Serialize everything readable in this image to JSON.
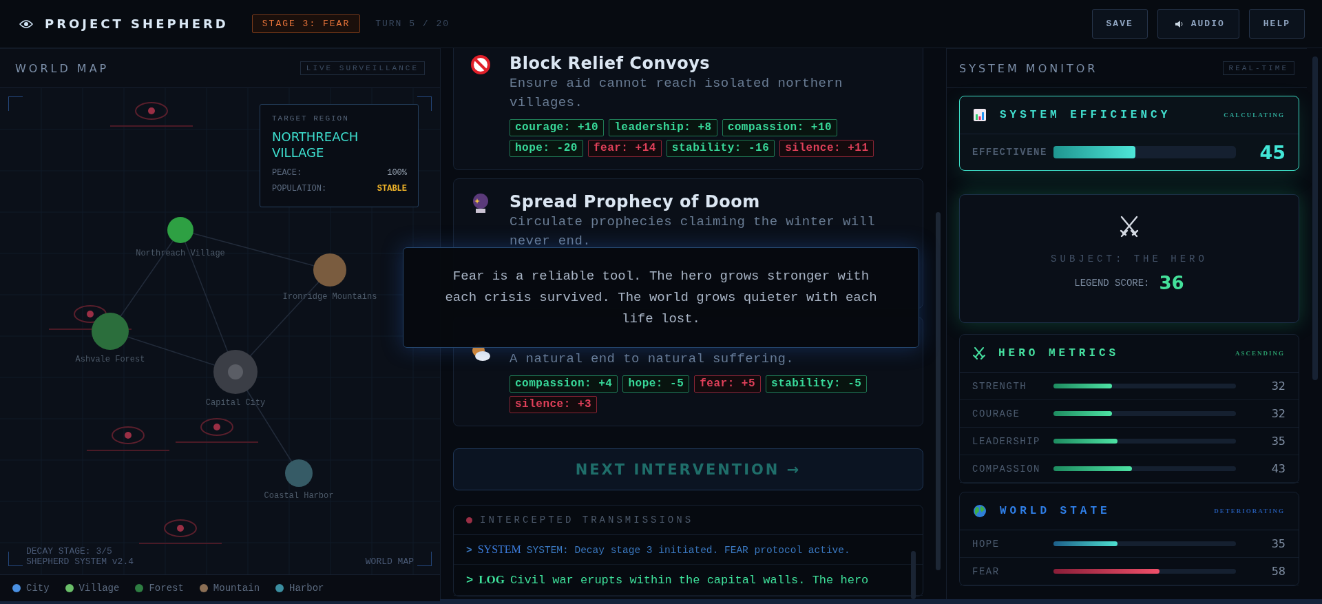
{
  "header": {
    "title": "PROJECT SHEPHERD",
    "stage": "STAGE 3: FEAR",
    "turn": "TURN 5 / 20",
    "buttons": [
      {
        "kind": "plain",
        "label": "SAVE"
      },
      {
        "kind": "audio",
        "label": "AUDIO"
      },
      {
        "kind": "plain",
        "label": "HELP"
      }
    ]
  },
  "map": {
    "title": "WORLD MAP",
    "badge": "LIVE SURVEILLANCE",
    "target": {
      "caption": "TARGET REGION",
      "name": "NORTHREACH VILLAGE",
      "stats": [
        {
          "label": "PEACE:",
          "value": "100%",
          "kind": "normal"
        },
        {
          "label": "POPULATION:",
          "value": "STABLE",
          "kind": "warn"
        }
      ]
    },
    "nodes": [
      {
        "name": "Northreach Village",
        "color": "#2ea043"
      },
      {
        "name": "Ironridge Mountains",
        "color": "#7a5c3f"
      },
      {
        "name": "Ashvale Forest",
        "color": "#2b6e3c"
      },
      {
        "name": "Capital City",
        "color": "#3b3e46"
      },
      {
        "name": "Coastal Harbor",
        "color": "#365b66"
      }
    ],
    "footer": [
      "DECAY STAGE: 3/5",
      "SHEPHERD SYSTEM v2.4"
    ],
    "corner_label": "WORLD MAP",
    "legend": [
      {
        "label": "City",
        "color": "#4a90e2"
      },
      {
        "label": "Village",
        "color": "#6abf69"
      },
      {
        "label": "Forest",
        "color": "#2e7d42"
      },
      {
        "label": "Mountain",
        "color": "#8b6f55"
      },
      {
        "label": "Harbor",
        "color": "#3b8ea0"
      }
    ]
  },
  "interventions": [
    {
      "title": "Block Relief Convoys",
      "description": "Ensure aid cannot reach isolated northern villages.",
      "effects": [
        {
          "text": "courage: +10",
          "kind": "good"
        },
        {
          "text": "leadership: +8",
          "kind": "good"
        },
        {
          "text": "compassion: +10",
          "kind": "good"
        },
        {
          "text": "hope: -20",
          "kind": "good"
        },
        {
          "text": "fear: +14",
          "kind": "bad"
        },
        {
          "text": "stability: -16",
          "kind": "good"
        },
        {
          "text": "silence: +11",
          "kind": "bad"
        }
      ]
    },
    {
      "title": "Spread Prophecy of Doom",
      "description": "Circulate prophecies claiming the winter will never end."
    },
    {
      "description": "A natural end to natural suffering.",
      "effects": [
        {
          "text": "compassion: +4",
          "kind": "good"
        },
        {
          "text": "hope: -5",
          "kind": "good"
        },
        {
          "text": "fear: +5",
          "kind": "bad"
        },
        {
          "text": "stability: -5",
          "kind": "good"
        },
        {
          "text": "silence: +3",
          "kind": "bad"
        }
      ]
    }
  ],
  "tooltip": "Fear is a reliable tool. The hero grows stronger with each crisis survived. The world grows quieter with each life lost.",
  "next_button": "NEXT INTERVENTION →",
  "transmissions": {
    "title": "INTERCEPTED TRANSMISSIONS",
    "entries": [
      {
        "kind": "system",
        "prompt": ">",
        "tag": "SYSTEM",
        "text": "SYSTEM: Decay stage 3 initiated. FEAR protocol active."
      },
      {
        "kind": "log",
        "prompt": ">",
        "tag": "LOG",
        "text": "Civil war erupts within the capital walls. The hero"
      }
    ]
  },
  "monitor": {
    "title": "SYSTEM MONITOR",
    "badge": "REAL-TIME",
    "efficiency": {
      "title": "SYSTEM EFFICIENCY",
      "status": "CALCULATING",
      "label": "EFFECTIVENE",
      "level": 0.45,
      "value": "45"
    },
    "hero": {
      "subject": "SUBJECT: THE HERO",
      "score_label": "LEGEND SCORE:",
      "score": "36"
    },
    "sections": [
      {
        "kind": "hero",
        "title": "HERO METRICS",
        "status": "ASCENDING",
        "rows": [
          {
            "label": "STRENGTH",
            "level": 0.32,
            "value": "32",
            "kind": "green"
          },
          {
            "label": "COURAGE",
            "level": 0.32,
            "value": "32",
            "kind": "green"
          },
          {
            "label": "LEADERSHIP",
            "level": 0.35,
            "value": "35",
            "kind": "green"
          },
          {
            "label": "COMPASSION",
            "level": 0.43,
            "value": "43",
            "kind": "green"
          }
        ]
      },
      {
        "kind": "world",
        "title": "WORLD STATE",
        "status": "DETERIORATING",
        "rows": [
          {
            "label": "HOPE",
            "level": 0.35,
            "value": "35",
            "kind": "teal"
          },
          {
            "label": "FEAR",
            "level": 0.58,
            "value": "58",
            "kind": "red"
          }
        ]
      }
    ]
  }
}
